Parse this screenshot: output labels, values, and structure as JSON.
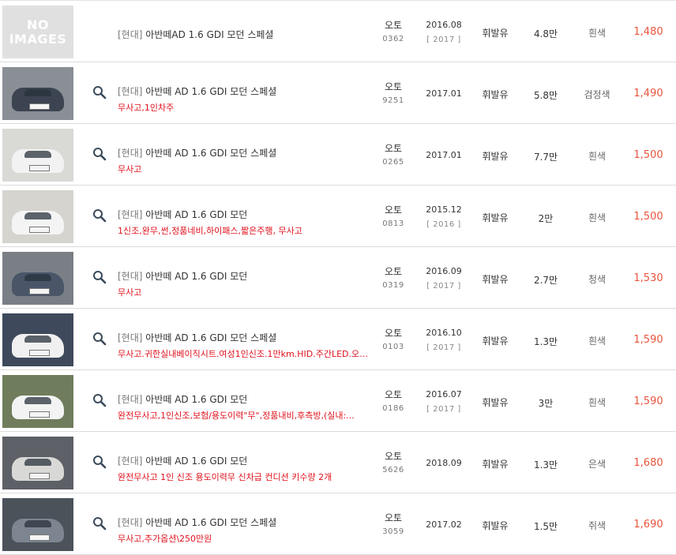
{
  "listings": [
    {
      "has_image": false,
      "no_image_text": "NO IMAGES",
      "has_search": false,
      "maker": "[현대]",
      "model": "아반떼AD 1.6 GDI 모던 스페셜",
      "note": "",
      "transmission": "오토",
      "code": "0362",
      "date": "2016.08",
      "year": "[ 2017 ]",
      "fuel": "휘발유",
      "mileage": "4.8만",
      "color": "흰색",
      "price": "1,480"
    },
    {
      "has_image": true,
      "photo_colors": {
        "bg": "#8a8f96",
        "car": "#3b4450"
      },
      "has_search": true,
      "maker": "[현대]",
      "model": "아반떼 AD 1.6 GDI 모던 스페셜",
      "note": "무사고,1인차주",
      "transmission": "오토",
      "code": "9251",
      "date": "2017.01",
      "year": "",
      "fuel": "휘발유",
      "mileage": "5.8만",
      "color": "검정색",
      "price": "1,490"
    },
    {
      "has_image": true,
      "photo_colors": {
        "bg": "#d9d9d6",
        "car": "#f2f2f2"
      },
      "has_search": true,
      "maker": "[현대]",
      "model": "아반떼 AD 1.6 GDI 모던 스페셜",
      "note": "무사고",
      "transmission": "오토",
      "code": "0265",
      "date": "2017.01",
      "year": "",
      "fuel": "휘발유",
      "mileage": "7.7만",
      "color": "흰색",
      "price": "1,500"
    },
    {
      "has_image": true,
      "photo_colors": {
        "bg": "#d5d4cf",
        "car": "#f4f4f4"
      },
      "has_search": true,
      "maker": "[현대]",
      "model": "아반떼 AD 1.6 GDI 모던",
      "note": "1신조,완무,썬,정품네비,하이패스,짧은주행, 무사고",
      "transmission": "오토",
      "code": "0813",
      "date": "2015.12",
      "year": "[ 2016 ]",
      "fuel": "휘발유",
      "mileage": "2만",
      "color": "흰색",
      "price": "1,500"
    },
    {
      "has_image": true,
      "photo_colors": {
        "bg": "#7a7f86",
        "car": "#4a5668"
      },
      "has_search": true,
      "maker": "[현대]",
      "model": "아반떼 AD 1.6 GDI 모던",
      "note": "무사고",
      "transmission": "오토",
      "code": "0319",
      "date": "2016.09",
      "year": "[ 2017 ]",
      "fuel": "휘발유",
      "mileage": "2.7만",
      "color": "청색",
      "price": "1,530"
    },
    {
      "has_image": true,
      "photo_colors": {
        "bg": "#3e4a5c",
        "car": "#f0f0f0"
      },
      "has_search": true,
      "maker": "[현대]",
      "model": "아반떼 AD 1.6 GDI 모던 스페셜",
      "note": "무사고.귀한실내베이직시트.여성1인신조.1만km.HID.주간LED.오일...",
      "transmission": "오토",
      "code": "0103",
      "date": "2016.10",
      "year": "[ 2017 ]",
      "fuel": "휘발유",
      "mileage": "1.3만",
      "color": "흰색",
      "price": "1,590"
    },
    {
      "has_image": true,
      "photo_colors": {
        "bg": "#6f7d5c",
        "car": "#f3f3f3"
      },
      "has_search": true,
      "maker": "[현대]",
      "model": "아반떼 AD 1.6 GDI 모던",
      "note": "완전무사고,1인신조,보험/용도이력\"무\",정품내비,후측방,(실내:...",
      "transmission": "오토",
      "code": "0186",
      "date": "2016.07",
      "year": "[ 2017 ]",
      "fuel": "휘발유",
      "mileage": "3만",
      "color": "흰색",
      "price": "1,590"
    },
    {
      "has_image": true,
      "photo_colors": {
        "bg": "#5d6066",
        "car": "#d8d8d6"
      },
      "has_search": true,
      "maker": "[현대]",
      "model": "아반떼 AD 1.6 GDI 모던",
      "note": "완전무사고 1인 신조 용도이력무 신차급 컨디션 키수량 2개",
      "transmission": "오토",
      "code": "5626",
      "date": "2018.09",
      "year": "",
      "fuel": "휘발유",
      "mileage": "1.3만",
      "color": "은색",
      "price": "1,680"
    },
    {
      "has_image": true,
      "photo_colors": {
        "bg": "#4b525a",
        "car": "#7c8590"
      },
      "has_search": true,
      "maker": "[현대]",
      "model": "아반떼 AD 1.6 GDI 모던 스페셜",
      "note": "무사고,추가옵션\\250만원",
      "transmission": "오토",
      "code": "3059",
      "date": "2017.02",
      "year": "",
      "fuel": "휘발유",
      "mileage": "1.5만",
      "color": "쥐색",
      "price": "1,690"
    }
  ]
}
